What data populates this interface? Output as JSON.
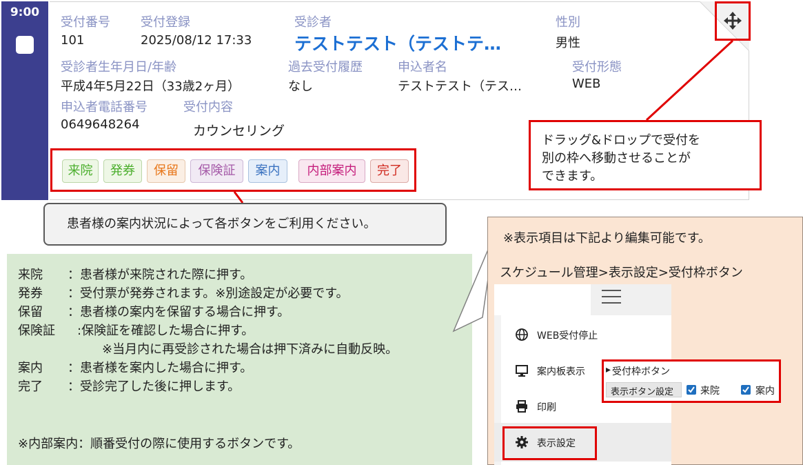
{
  "card": {
    "time": "9:00",
    "fields": {
      "reception_no_label": "受付番号",
      "reception_no": "101",
      "reception_reg_label": "受付登録",
      "reception_reg": "2025/08/12 17:33",
      "patient_label": "受診者",
      "patient_name": "テストテスト（テストテ…",
      "gender_label": "性別",
      "gender": "男性",
      "birth_label": "受診者生年月日/年齢",
      "birth": "平成4年5月22日（33歳2ヶ月）",
      "history_label": "過去受付履歴",
      "history": "なし",
      "applicant_label": "申込者名",
      "applicant": "テストテスト（テス…",
      "form_label": "受付形態",
      "form": "WEB",
      "phone_label": "申込者電話番号",
      "phone": "0649648264",
      "content_label": "受付内容",
      "content": "カウンセリング"
    },
    "status_buttons": [
      {
        "label": "来院",
        "color": "#4caf2e"
      },
      {
        "label": "発券",
        "color": "#4caf2e"
      },
      {
        "label": "保留",
        "color": "#e8771b"
      },
      {
        "label": "保険証",
        "color": "#a55aa8"
      },
      {
        "label": "案内",
        "color": "#3a72c0"
      },
      {
        "label": "内部案内",
        "color": "#c51d7c"
      },
      {
        "label": "完了",
        "color": "#d02a20"
      }
    ],
    "move_icon": "move-arrows-icon"
  },
  "drag_note": {
    "lines": [
      "ドラッグ&ドロップで受付を",
      "別の枠へ移動させることが",
      "できます。"
    ]
  },
  "callout": {
    "text": "患者様の案内状況によって各ボタンをご利用ください。"
  },
  "explanations": {
    "rows": [
      {
        "term": "来院",
        "desc": "：患者様が来院された際に押す。"
      },
      {
        "term": "発券",
        "desc": "：受付票が発券されます。※別途設定が必要です。"
      },
      {
        "term": "保留",
        "desc": "：患者様の案内を保留する場合に押す。"
      },
      {
        "term": "保険証",
        "desc": ":保険証を確認した場合に押す。"
      },
      {
        "term": "",
        "desc": "※当月内に再受診された場合は押下済みに自動反映。"
      },
      {
        "term": "案内",
        "desc": "：患者様を案内した場合に押す。"
      },
      {
        "term": "完了",
        "desc": "：受診完了した後に押します。"
      }
    ],
    "footer": "※内部案内：順番受付の際に使用するボタンです。"
  },
  "settings_note": {
    "line1": "※表示項目は下記より編集可能です。",
    "line2": "スケジュール管理>表示設定>受付枠ボタン"
  },
  "menu": {
    "hamburger_icon": "hamburger-menu-icon",
    "items": [
      {
        "label": "WEB受付停止",
        "icon": "globe-icon"
      },
      {
        "label": "案内板表示",
        "icon": "monitor-icon"
      },
      {
        "label": "印刷",
        "icon": "printer-icon"
      },
      {
        "label": "表示設定",
        "icon": "gear-icon"
      }
    ]
  },
  "button_settings": {
    "title": "受付枠ボタン",
    "row_label": "表示ボタン設定",
    "options": [
      {
        "label": "来院",
        "checked": true
      },
      {
        "label": "案内",
        "checked": true
      }
    ]
  }
}
